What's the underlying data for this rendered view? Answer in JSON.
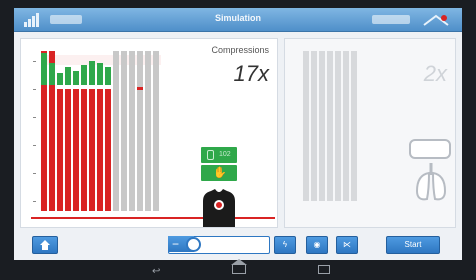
{
  "topbar": {
    "title": "Simulation"
  },
  "left_panel": {
    "compressions_label": "Compressions",
    "compressions_count": "17x",
    "indicator_rate": "102"
  },
  "right_panel": {
    "ventilations_count": "2x"
  },
  "controls": {
    "start_label": "Start",
    "slider_level": 0.25
  },
  "colors": {
    "compression_bar": "#d92424",
    "good_depth": "#2fa84a",
    "accent": "#2e77c2"
  },
  "icons": {
    "home": "home-icon",
    "minus": "minus-icon",
    "defib": "lightning-icon",
    "eye": "eye-icon",
    "link": "share-icon"
  }
}
